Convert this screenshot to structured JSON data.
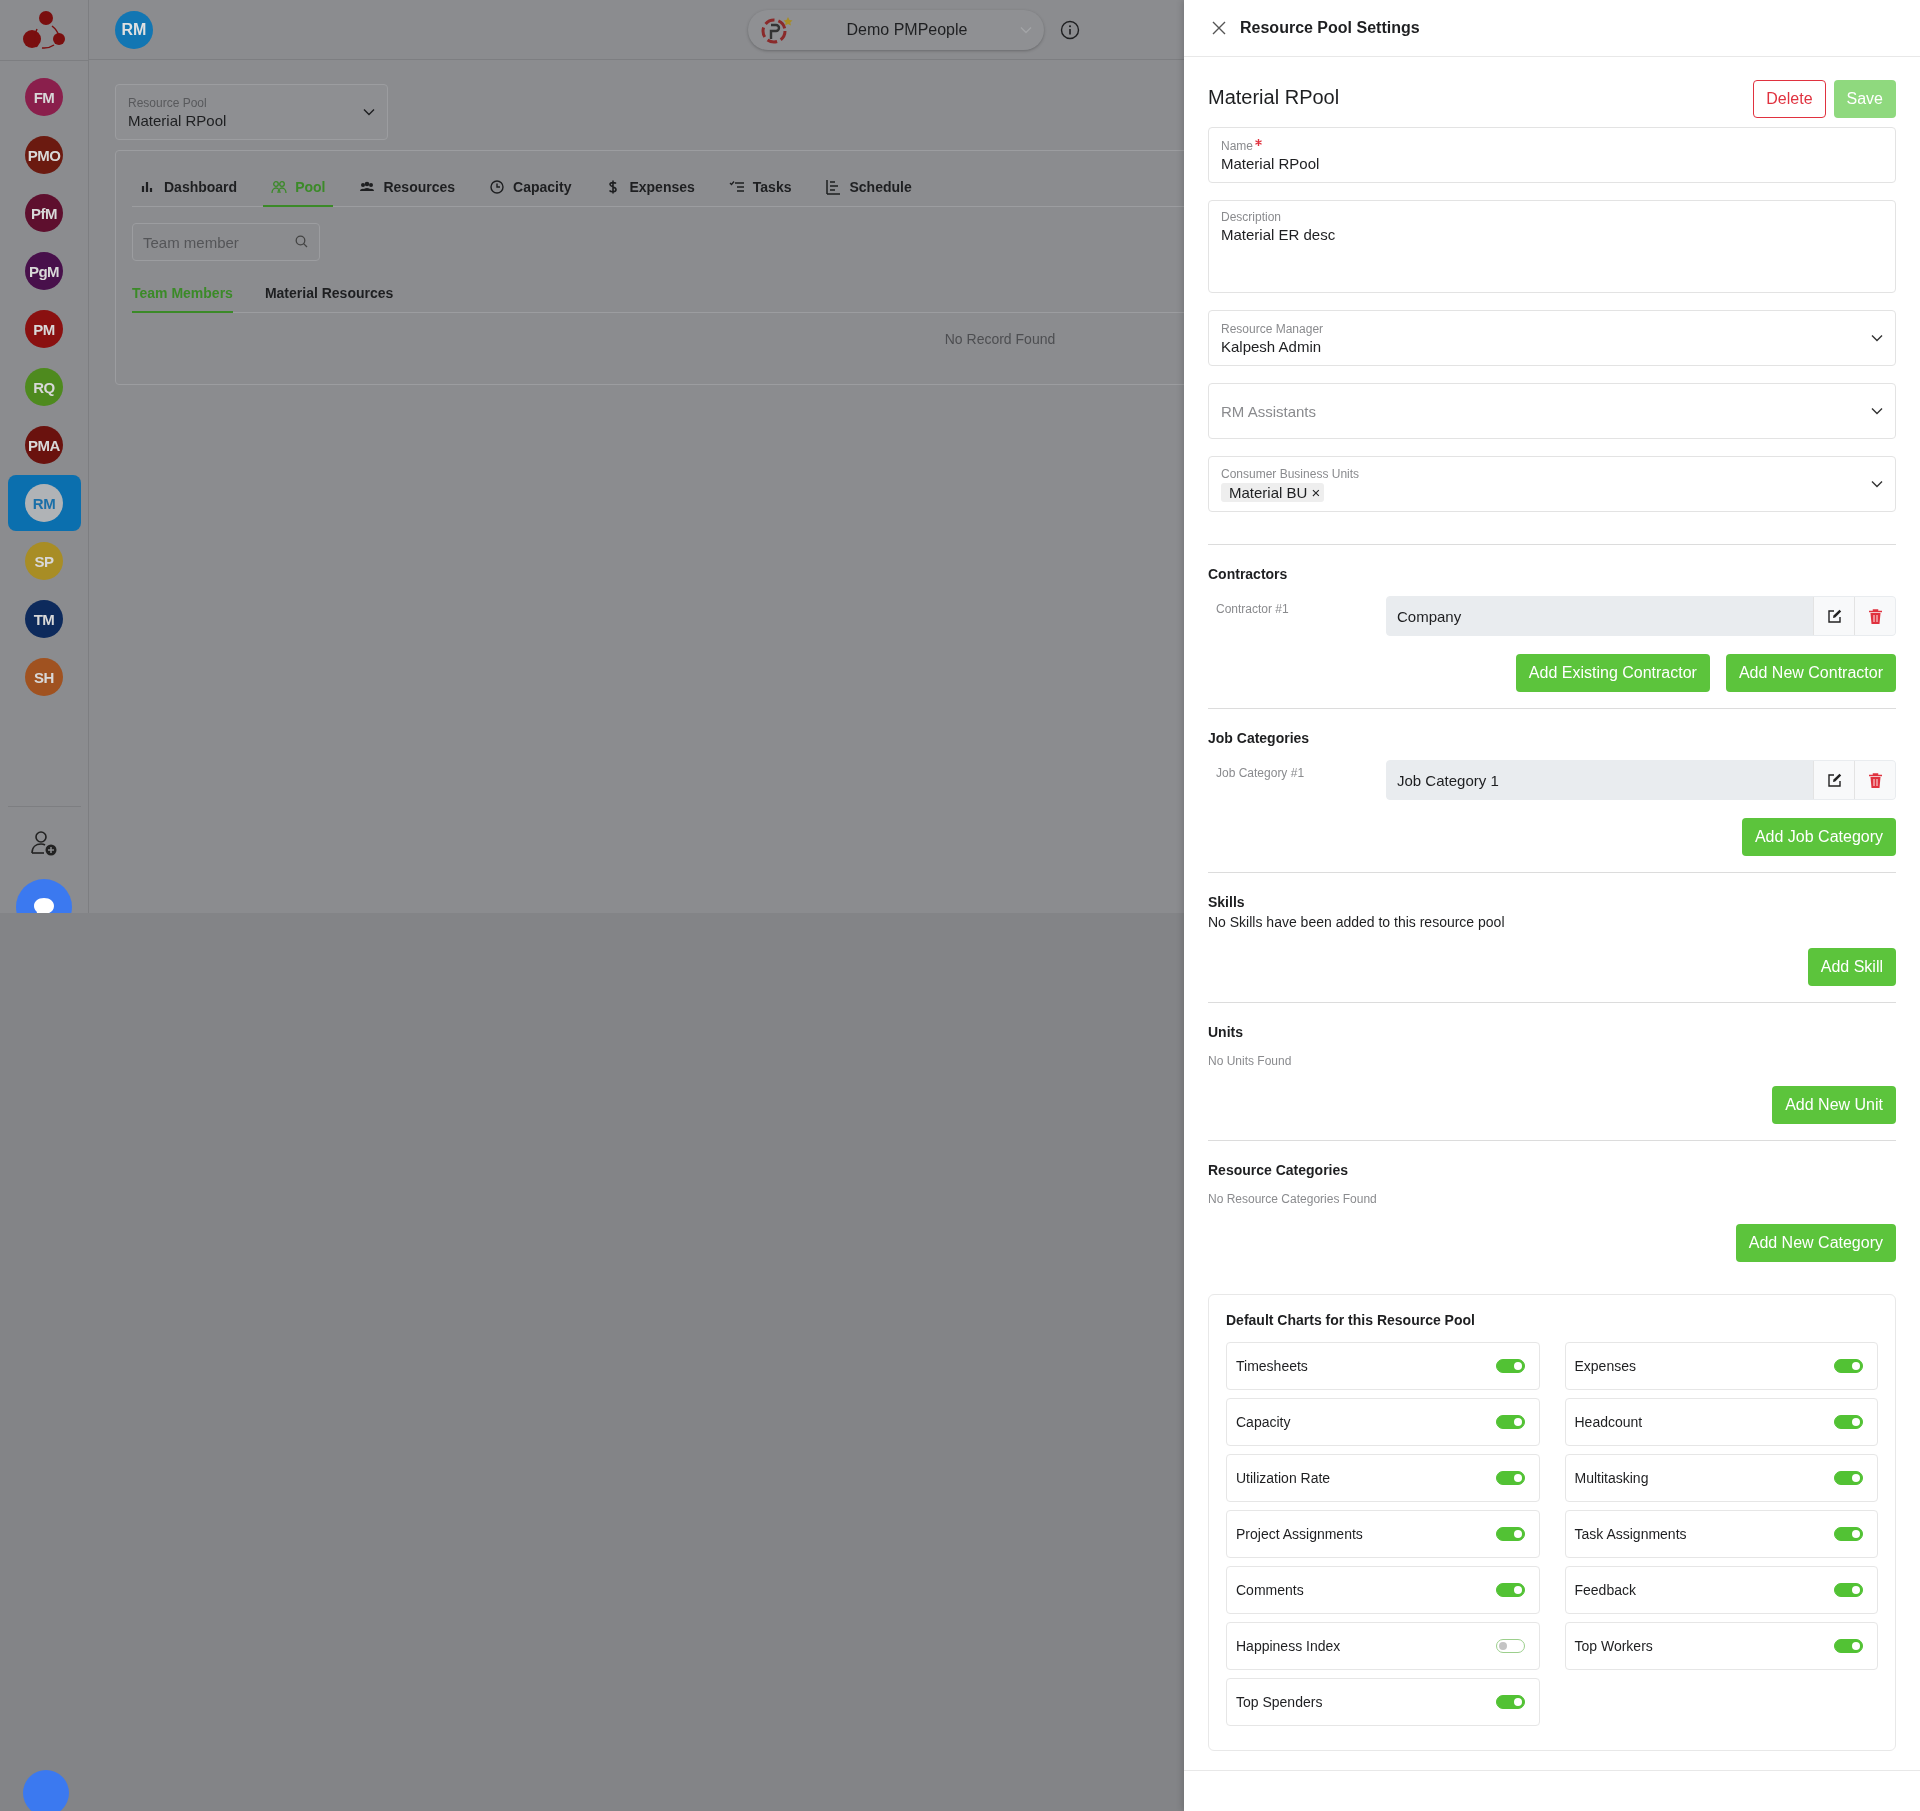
{
  "sidebar": {
    "avatars": [
      {
        "label": "FM",
        "color": "#8a1f4c",
        "selected": false
      },
      {
        "label": "PMO",
        "color": "#6b1a10",
        "selected": false
      },
      {
        "label": "PfM",
        "color": "#5e0f2e",
        "selected": false
      },
      {
        "label": "PgM",
        "color": "#48104b",
        "selected": false
      },
      {
        "label": "PM",
        "color": "#8a1010",
        "selected": false
      },
      {
        "label": "RQ",
        "color": "#4e8a1e",
        "selected": false
      },
      {
        "label": "PMA",
        "color": "#6a120e",
        "selected": false
      },
      {
        "label": "RM",
        "color": "#b0b3b6",
        "selected": true
      },
      {
        "label": "SP",
        "color": "#a88d25",
        "selected": false
      },
      {
        "label": "TM",
        "color": "#0d2a5c",
        "selected": false
      },
      {
        "label": "SH",
        "color": "#a05220",
        "selected": false
      }
    ]
  },
  "top_bar": {
    "user_initials": "RM",
    "workspace": "Demo PMPeople"
  },
  "resource_pool_select": {
    "label": "Resource Pool",
    "value": "Material RPool"
  },
  "tabs": [
    {
      "label": "Dashboard",
      "selected": false
    },
    {
      "label": "Pool",
      "selected": true
    },
    {
      "label": "Resources",
      "selected": false
    },
    {
      "label": "Capacity",
      "selected": false
    },
    {
      "label": "Expenses",
      "selected": false
    },
    {
      "label": "Tasks",
      "selected": false
    },
    {
      "label": "Schedule",
      "selected": false
    }
  ],
  "search": {
    "placeholder": "Team member"
  },
  "sub_tabs": [
    {
      "label": "Team Members",
      "selected": true
    },
    {
      "label": "Material Resources",
      "selected": false
    }
  ],
  "empty_message": "No Record Found",
  "panel": {
    "title": "Resource Pool Settings",
    "heading": "Material RPool",
    "delete_button": "Delete",
    "save_button": {
      "label": "Save",
      "disabled": true
    },
    "fields": [
      {
        "kind": "text",
        "label": "Name",
        "required": true,
        "value": "Material RPool"
      },
      {
        "kind": "textarea",
        "label": "Description",
        "required": false,
        "value": "Material ER desc"
      },
      {
        "kind": "select",
        "label": "Resource Manager",
        "required": false,
        "value": "Kalpesh Admin"
      },
      {
        "kind": "select",
        "placeholder": "RM Assistants",
        "required": false
      },
      {
        "kind": "multiselect",
        "label": "Consumer Business Units",
        "required": false,
        "chips": [
          {
            "label": "Material BU",
            "remove": "×"
          }
        ]
      }
    ],
    "sections": [
      {
        "kind": "items",
        "title": "Contractors",
        "items": [
          {
            "label": "Contractor #1",
            "value": "Company"
          }
        ],
        "buttons": [
          "Add Existing Contractor",
          "Add New Contractor"
        ]
      },
      {
        "kind": "items",
        "title": "Job Categories",
        "items": [
          {
            "label": "Job Category #1",
            "value": "Job Category 1"
          }
        ],
        "buttons": [
          "Add Job Category"
        ]
      },
      {
        "kind": "note",
        "title": "Skills",
        "message": "No Skills have been added to this resource pool",
        "buttons": [
          "Add Skill"
        ]
      },
      {
        "kind": "empty",
        "title": "Units",
        "message": "No Units Found",
        "buttons": [
          "Add New Unit"
        ]
      },
      {
        "kind": "empty",
        "title": "Resource Categories",
        "message": "No Resource Categories Found",
        "buttons": [
          "Add New Category"
        ]
      }
    ],
    "charts": {
      "title": "Default Charts for this Resource Pool",
      "toggles": [
        {
          "label": "Timesheets",
          "on": true
        },
        {
          "label": "Expenses",
          "on": true
        },
        {
          "label": "Capacity",
          "on": true
        },
        {
          "label": "Headcount",
          "on": true
        },
        {
          "label": "Utilization Rate",
          "on": true
        },
        {
          "label": "Multitasking",
          "on": true
        },
        {
          "label": "Project Assignments",
          "on": true
        },
        {
          "label": "Task Assignments",
          "on": true
        },
        {
          "label": "Comments",
          "on": true
        },
        {
          "label": "Feedback",
          "on": true
        },
        {
          "label": "Happiness Index",
          "on": false
        },
        {
          "label": "Top Workers",
          "on": true
        },
        {
          "label": "Top Spenders",
          "on": true
        }
      ]
    }
  }
}
